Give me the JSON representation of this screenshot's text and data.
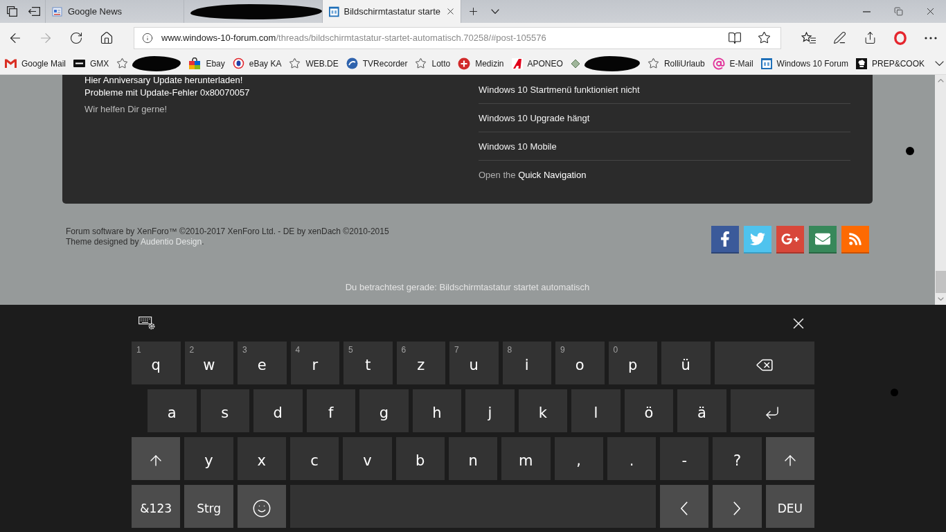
{
  "tabs": [
    {
      "kind": "news",
      "title": "Google News",
      "selected": false
    },
    {
      "kind": "redacted",
      "selected": false
    },
    {
      "kind": "forum",
      "title": "Bildschirmtastatur starte",
      "selected": true
    }
  ],
  "navigation": {
    "back_disabled": false,
    "forward_disabled": true
  },
  "address_bar": {
    "host": "www.windows-10-forum.com",
    "path": "/threads/bildschirmtastatur-startet-automatisch.70258/#post-105576"
  },
  "favorites": [
    {
      "kind": "mail",
      "label": "Google Mail",
      "redacted": false
    },
    {
      "kind": "logo",
      "label": "GMX",
      "redacted": false
    },
    {
      "kind": "star",
      "redacted": true
    },
    {
      "kind": "bag",
      "label": "Ebay",
      "redacted": false
    },
    {
      "kind": "ring",
      "label": "eBay KA",
      "redacted": false
    },
    {
      "kind": "star",
      "label": "WEB.DE",
      "redacted": false
    },
    {
      "kind": "disc",
      "label": "TVRecorder",
      "redacted": false
    },
    {
      "kind": "star",
      "label": "Lotto",
      "redacted": false
    },
    {
      "kind": "cross",
      "label": "Medizin",
      "redacted": false
    },
    {
      "kind": "triangle",
      "label": "APONEO",
      "redacted": false
    },
    {
      "kind": "tag",
      "redacted": true
    },
    {
      "kind": "star",
      "label": "RolliUrlaub",
      "redacted": false
    },
    {
      "kind": "at",
      "label": "E-Mail",
      "redacted": false
    },
    {
      "kind": "window",
      "label": "Windows 10 Forum",
      "redacted": false
    },
    {
      "kind": "chef",
      "label": "PREP&COOK",
      "redacted": false
    }
  ],
  "forum_panel": {
    "left_links": [
      {
        "kind": "link",
        "text": "Hier Anniversary Update herunterladen!"
      },
      {
        "kind": "link",
        "text": "Probleme mit Update-Fehler 0x80070057"
      },
      {
        "kind": "note",
        "text": "Wir helfen Dir gerne!"
      }
    ],
    "right_links": [
      "Windows 10 Startmenü funktioniert nicht",
      "Windows 10 Upgrade hängt",
      "Windows 10 Mobile"
    ],
    "quick_navigation": {
      "before": "Open the",
      "link": "Quick Navigation"
    }
  },
  "footer": {
    "copyright": "Forum software by XenForo™ ©2010-2017 XenForo Ltd. - DE by xenDach ©2010-2015",
    "theme_credit": {
      "before": "Theme designed by",
      "link": "Audentio Design",
      "after": "."
    },
    "share_buttons": [
      {
        "kind": "facebook"
      },
      {
        "kind": "twitter"
      },
      {
        "kind": "google-plus"
      },
      {
        "kind": "email"
      },
      {
        "kind": "rss"
      }
    ],
    "viewing": "Du betrachtest gerade: Bildschirmtastatur startet automatisch"
  },
  "keyboard": {
    "rows": [
      [
        {
          "kind": "char",
          "label": "q",
          "hint": "1"
        },
        {
          "kind": "char",
          "label": "w",
          "hint": "2"
        },
        {
          "kind": "char",
          "label": "e",
          "hint": "3"
        },
        {
          "kind": "char",
          "label": "r",
          "hint": "4"
        },
        {
          "kind": "char",
          "label": "t",
          "hint": "5"
        },
        {
          "kind": "char",
          "label": "z",
          "hint": "6"
        },
        {
          "kind": "char",
          "label": "u",
          "hint": "7"
        },
        {
          "kind": "char",
          "label": "i",
          "hint": "8"
        },
        {
          "kind": "char",
          "label": "o",
          "hint": "9"
        },
        {
          "kind": "char",
          "label": "p",
          "hint": "0"
        },
        {
          "kind": "char",
          "label": "ü"
        },
        {
          "kind": "backspace"
        }
      ],
      [
        {
          "kind": "char",
          "label": "a"
        },
        {
          "kind": "char",
          "label": "s"
        },
        {
          "kind": "char",
          "label": "d"
        },
        {
          "kind": "char",
          "label": "f"
        },
        {
          "kind": "char",
          "label": "g"
        },
        {
          "kind": "char",
          "label": "h"
        },
        {
          "kind": "char",
          "label": "j"
        },
        {
          "kind": "char",
          "label": "k"
        },
        {
          "kind": "char",
          "label": "l"
        },
        {
          "kind": "char",
          "label": "ö"
        },
        {
          "kind": "char",
          "label": "ä"
        },
        {
          "kind": "enter"
        }
      ],
      [
        {
          "kind": "shift"
        },
        {
          "kind": "char",
          "label": "y"
        },
        {
          "kind": "char",
          "label": "x"
        },
        {
          "kind": "char",
          "label": "c"
        },
        {
          "kind": "char",
          "label": "v"
        },
        {
          "kind": "char",
          "label": "b"
        },
        {
          "kind": "char",
          "label": "n"
        },
        {
          "kind": "char",
          "label": "m"
        },
        {
          "kind": "char",
          "label": ","
        },
        {
          "kind": "char",
          "label": "."
        },
        {
          "kind": "char",
          "label": "-"
        },
        {
          "kind": "char",
          "label": "?"
        },
        {
          "kind": "shift"
        }
      ],
      [
        {
          "kind": "text",
          "label": "&123"
        },
        {
          "kind": "text",
          "label": "Strg"
        },
        {
          "kind": "emoji"
        },
        {
          "kind": "space"
        },
        {
          "kind": "left"
        },
        {
          "kind": "right"
        },
        {
          "kind": "text",
          "label": "DEU"
        }
      ]
    ]
  }
}
